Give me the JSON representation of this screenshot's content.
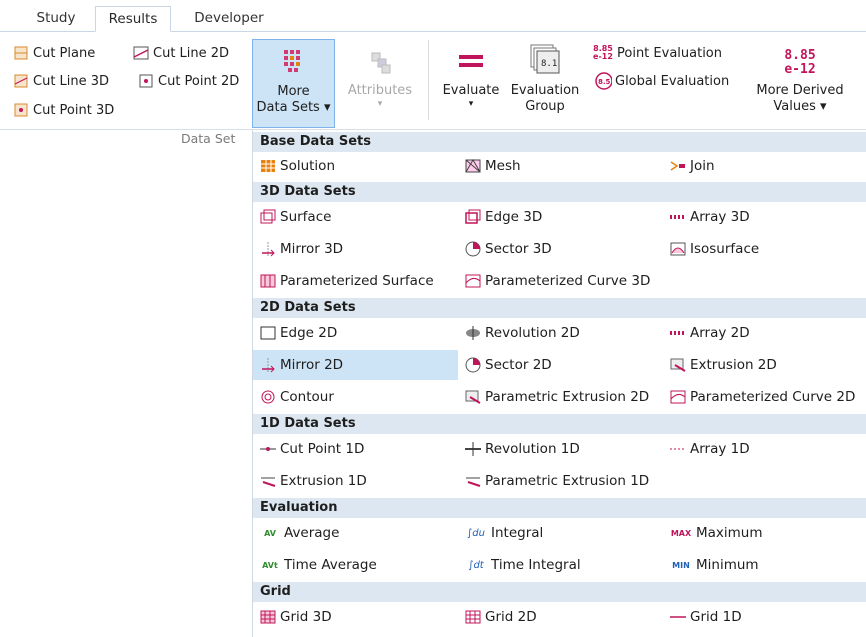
{
  "tabs": [
    {
      "label": "Study"
    },
    {
      "label": "Results"
    },
    {
      "label": "Developer"
    }
  ],
  "ribbon": {
    "dataset_items": [
      {
        "label": "Cut Plane",
        "icon": "cut-plane-icon"
      },
      {
        "label": "Cut Line 2D",
        "icon": "cut-line-2d-icon"
      },
      {
        "label": "Cut Line 3D",
        "icon": "cut-line-3d-icon"
      },
      {
        "label": "Cut Point 2D",
        "icon": "cut-point-2d-icon"
      },
      {
        "label": "Cut Point 3D",
        "icon": "cut-point-3d-icon"
      }
    ],
    "group_label": "Data Set",
    "more_data_sets": {
      "line1": "More",
      "line2": "Data Sets ▾"
    },
    "attributes": {
      "label": "Attributes",
      "caret": "▾"
    },
    "evaluate": {
      "label": "Evaluate",
      "caret": "▾"
    },
    "evaluation_group": {
      "line1": "Evaluation",
      "line2": "Group",
      "icon_text": "8.1"
    },
    "point_evaluation": {
      "label": "Point Evaluation",
      "icon_text_top": "8.85",
      "icon_text_bottom": "e-12"
    },
    "global_evaluation": {
      "label": "Global Evaluation",
      "icon_text": "8.5"
    },
    "more_derived": {
      "icon_top": "8.85",
      "icon_bottom": "e-12",
      "line1": "More Derived",
      "line2": "Values ▾"
    }
  },
  "menu": {
    "sections": [
      {
        "title": "Base Data Sets"
      },
      {
        "title": "3D Data Sets"
      },
      {
        "title": "2D Data Sets"
      },
      {
        "title": "1D Data Sets"
      },
      {
        "title": "Evaluation"
      },
      {
        "title": "Grid"
      }
    ],
    "items": {
      "solution": "Solution",
      "mesh": "Mesh",
      "join": "Join",
      "surface": "Surface",
      "edge3d": "Edge 3D",
      "array3d": "Array 3D",
      "mirror3d": "Mirror 3D",
      "sector3d": "Sector 3D",
      "isosurface": "Isosurface",
      "param_surface": "Parameterized Surface",
      "param_curve3d": "Parameterized Curve 3D",
      "edge2d": "Edge 2D",
      "revolution2d": "Revolution 2D",
      "array2d": "Array 2D",
      "mirror2d": "Mirror 2D",
      "sector2d": "Sector 2D",
      "extrusion2d": "Extrusion 2D",
      "contour": "Contour",
      "param_extrusion2d": "Parametric Extrusion 2D",
      "param_curve2d": "Parameterized Curve 2D",
      "cutpoint1d": "Cut Point 1D",
      "revolution1d": "Revolution 1D",
      "array1d": "Array 1D",
      "extrusion1d": "Extrusion 1D",
      "param_extrusion1d": "Parametric Extrusion 1D",
      "average": "Average",
      "integral": "Integral",
      "maximum": "Maximum",
      "time_average": "Time Average",
      "time_integral": "Time Integral",
      "minimum": "Minimum",
      "grid3d": "Grid 3D",
      "grid2d": "Grid 2D",
      "grid1d": "Grid 1D"
    },
    "icon_text": {
      "av": "AV",
      "avt": "AVt",
      "idu": "∫du",
      "idt": "∫dt",
      "max": "MAX",
      "min": "MIN"
    },
    "highlighted": "Mirror 2D"
  },
  "colors": {
    "accent": "#cde4f7",
    "section_bg": "#dde7f1",
    "icon_red": "#c0155a",
    "icon_orange": "#e8820e"
  }
}
